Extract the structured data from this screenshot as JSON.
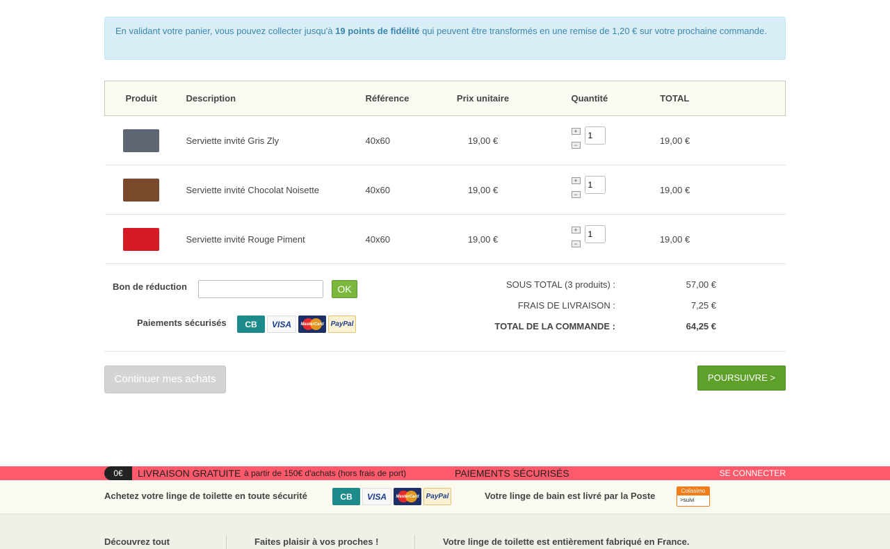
{
  "loyalty_notice": {
    "prefix": "En validant votre panier, vous pouvez collecter jusqu'à ",
    "points": "19 points de fidélité",
    "suffix": " qui peuvent être transformés en une remise de 1,20 € sur votre prochaine commande."
  },
  "cart": {
    "headers": {
      "product": "Produit",
      "description": "Description",
      "reference": "Référence",
      "unit_price": "Prix unitaire",
      "quantity": "Quantité",
      "total": "TOTAL"
    },
    "items": [
      {
        "description": "Serviette invité Gris Zly",
        "reference": "40x60",
        "unit_price": "19,00 €",
        "quantity": "1",
        "total": "19,00 €",
        "color": "#5e6674"
      },
      {
        "description": "Serviette invité Chocolat Noisette",
        "reference": "40x60",
        "unit_price": "19,00 €",
        "quantity": "1",
        "total": "19,00 €",
        "color": "#7a4a2c"
      },
      {
        "description": "Serviette invité Rouge Piment",
        "reference": "40x60",
        "unit_price": "19,00 €",
        "quantity": "1",
        "total": "19,00 €",
        "color": "#d41a24"
      }
    ],
    "qty_plus": "+",
    "qty_minus": "−"
  },
  "coupon": {
    "label": "Bon de réduction",
    "placeholder": "",
    "ok_label": "OK"
  },
  "secure_payments": {
    "label": "Paiements sécurisés",
    "logos": [
      "CB",
      "VISA",
      "MasterCard",
      "PayPal"
    ]
  },
  "summary": {
    "subtotal_label": "SOUS TOTAL (3 produits) :",
    "subtotal_value": "57,00 €",
    "shipping_label": "FRAIS DE LIVRAISON :",
    "shipping_value": "7,25 €",
    "order_total_label": "TOTAL DE LA COMMANDE :",
    "order_total_value": "64,25 €"
  },
  "actions": {
    "continue_label": "Continuer mes achats",
    "next_label": "POURSUIVRE >"
  },
  "promo_band": {
    "badge": "0€",
    "free_delivery": "LIVRAISON GRATUITE",
    "free_delivery_detail": "à partir de 150€ d'achats (hors frais de port)",
    "secure": "PAIEMENTS SÉCURISÉS",
    "login": "SE CONNECTER"
  },
  "trust_strip": {
    "buy_safely": "Achetez votre linge de toilette en toute sécurité",
    "delivered_by": "Votre linge de bain est livré par la Poste",
    "colissimo_top": "Colissimo",
    "colissimo_bottom": ">suivi"
  },
  "footer": {
    "col1": "Découvrez tout",
    "col2": "Faites plaisir à vos proches !",
    "col3": "Votre linge de toilette est entièrement fabriqué en France."
  },
  "colors": {
    "accent_green": "#5ea12a",
    "promo_red": "#ff5a6b",
    "info_blue": "#3a87ad"
  }
}
